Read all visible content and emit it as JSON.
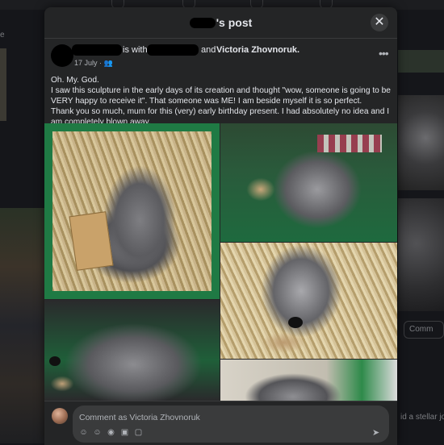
{
  "modal": {
    "title_suffix": "'s post",
    "close_icon": "close-icon"
  },
  "post": {
    "is_with": "is with",
    "and": "and",
    "tagged_name": "Victoria Zhovnoruk",
    "tagged_suffix": ".",
    "date": "17 July",
    "audience_icon": "friends-icon",
    "more_icon": "more-icon",
    "text": [
      "Oh. My. God.",
      "I saw this sculpture in the early days of its creation and thought \"wow, someone is going to be VERY happy to receive it\". That someone was ME! I am beside myself it is so perfect.",
      "Thank you so much, mum for this (very) early birthday present. I had absolutely no idea and I am completely blown away."
    ]
  },
  "comment": {
    "placeholder": "Comment as Victoria Zhovnoruk",
    "icons": [
      "avatar-icon",
      "emoji-icon",
      "camera-icon",
      "gif-icon",
      "sticker-icon"
    ],
    "send_icon": "send-icon"
  },
  "background": {
    "comment_label": "Comm",
    "feed_text": "id a stellar jo"
  }
}
